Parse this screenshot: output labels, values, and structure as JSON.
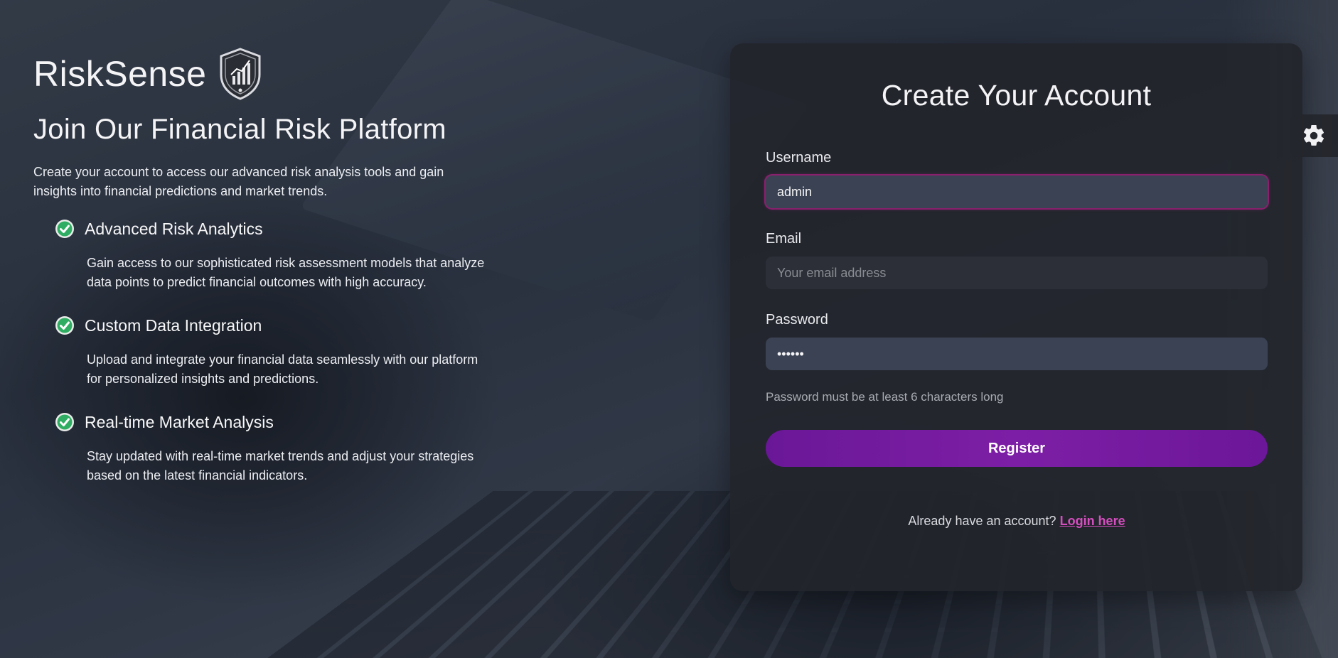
{
  "brand": {
    "name": "RiskSense",
    "logo_icon": "shield-chart-icon"
  },
  "left": {
    "tagline": "Join Our Financial Risk Platform",
    "intro": "Create your account to access our advanced risk analysis tools and gain insights into financial predictions and market trends.",
    "features": [
      {
        "icon": "check-circle-icon",
        "title": "Advanced Risk Analytics",
        "desc": "Gain access to our sophisticated risk assessment models that analyze data points to predict financial outcomes with high accuracy."
      },
      {
        "icon": "check-circle-icon",
        "title": "Custom Data Integration",
        "desc": "Upload and integrate your financial data seamlessly with our platform for personalized insights and predictions."
      },
      {
        "icon": "check-circle-icon",
        "title": "Real-time Market Analysis",
        "desc": "Stay updated with real-time market trends and adjust your strategies based on the latest financial indicators."
      }
    ]
  },
  "form": {
    "title": "Create Your Account",
    "username": {
      "label": "Username",
      "value": "admin",
      "placeholder": ""
    },
    "email": {
      "label": "Email",
      "value": "",
      "placeholder": "Your email address"
    },
    "password": {
      "label": "Password",
      "value": "••••••",
      "placeholder": ""
    },
    "hint": "Password must be at least 6 characters long",
    "submit_label": "Register",
    "login_prompt": "Already have an account?",
    "login_link": "Login here"
  },
  "settings": {
    "icon": "gear-icon"
  },
  "colors": {
    "accent": "#7d1fa6",
    "link": "#d64fc0",
    "check": "#2fae63"
  }
}
